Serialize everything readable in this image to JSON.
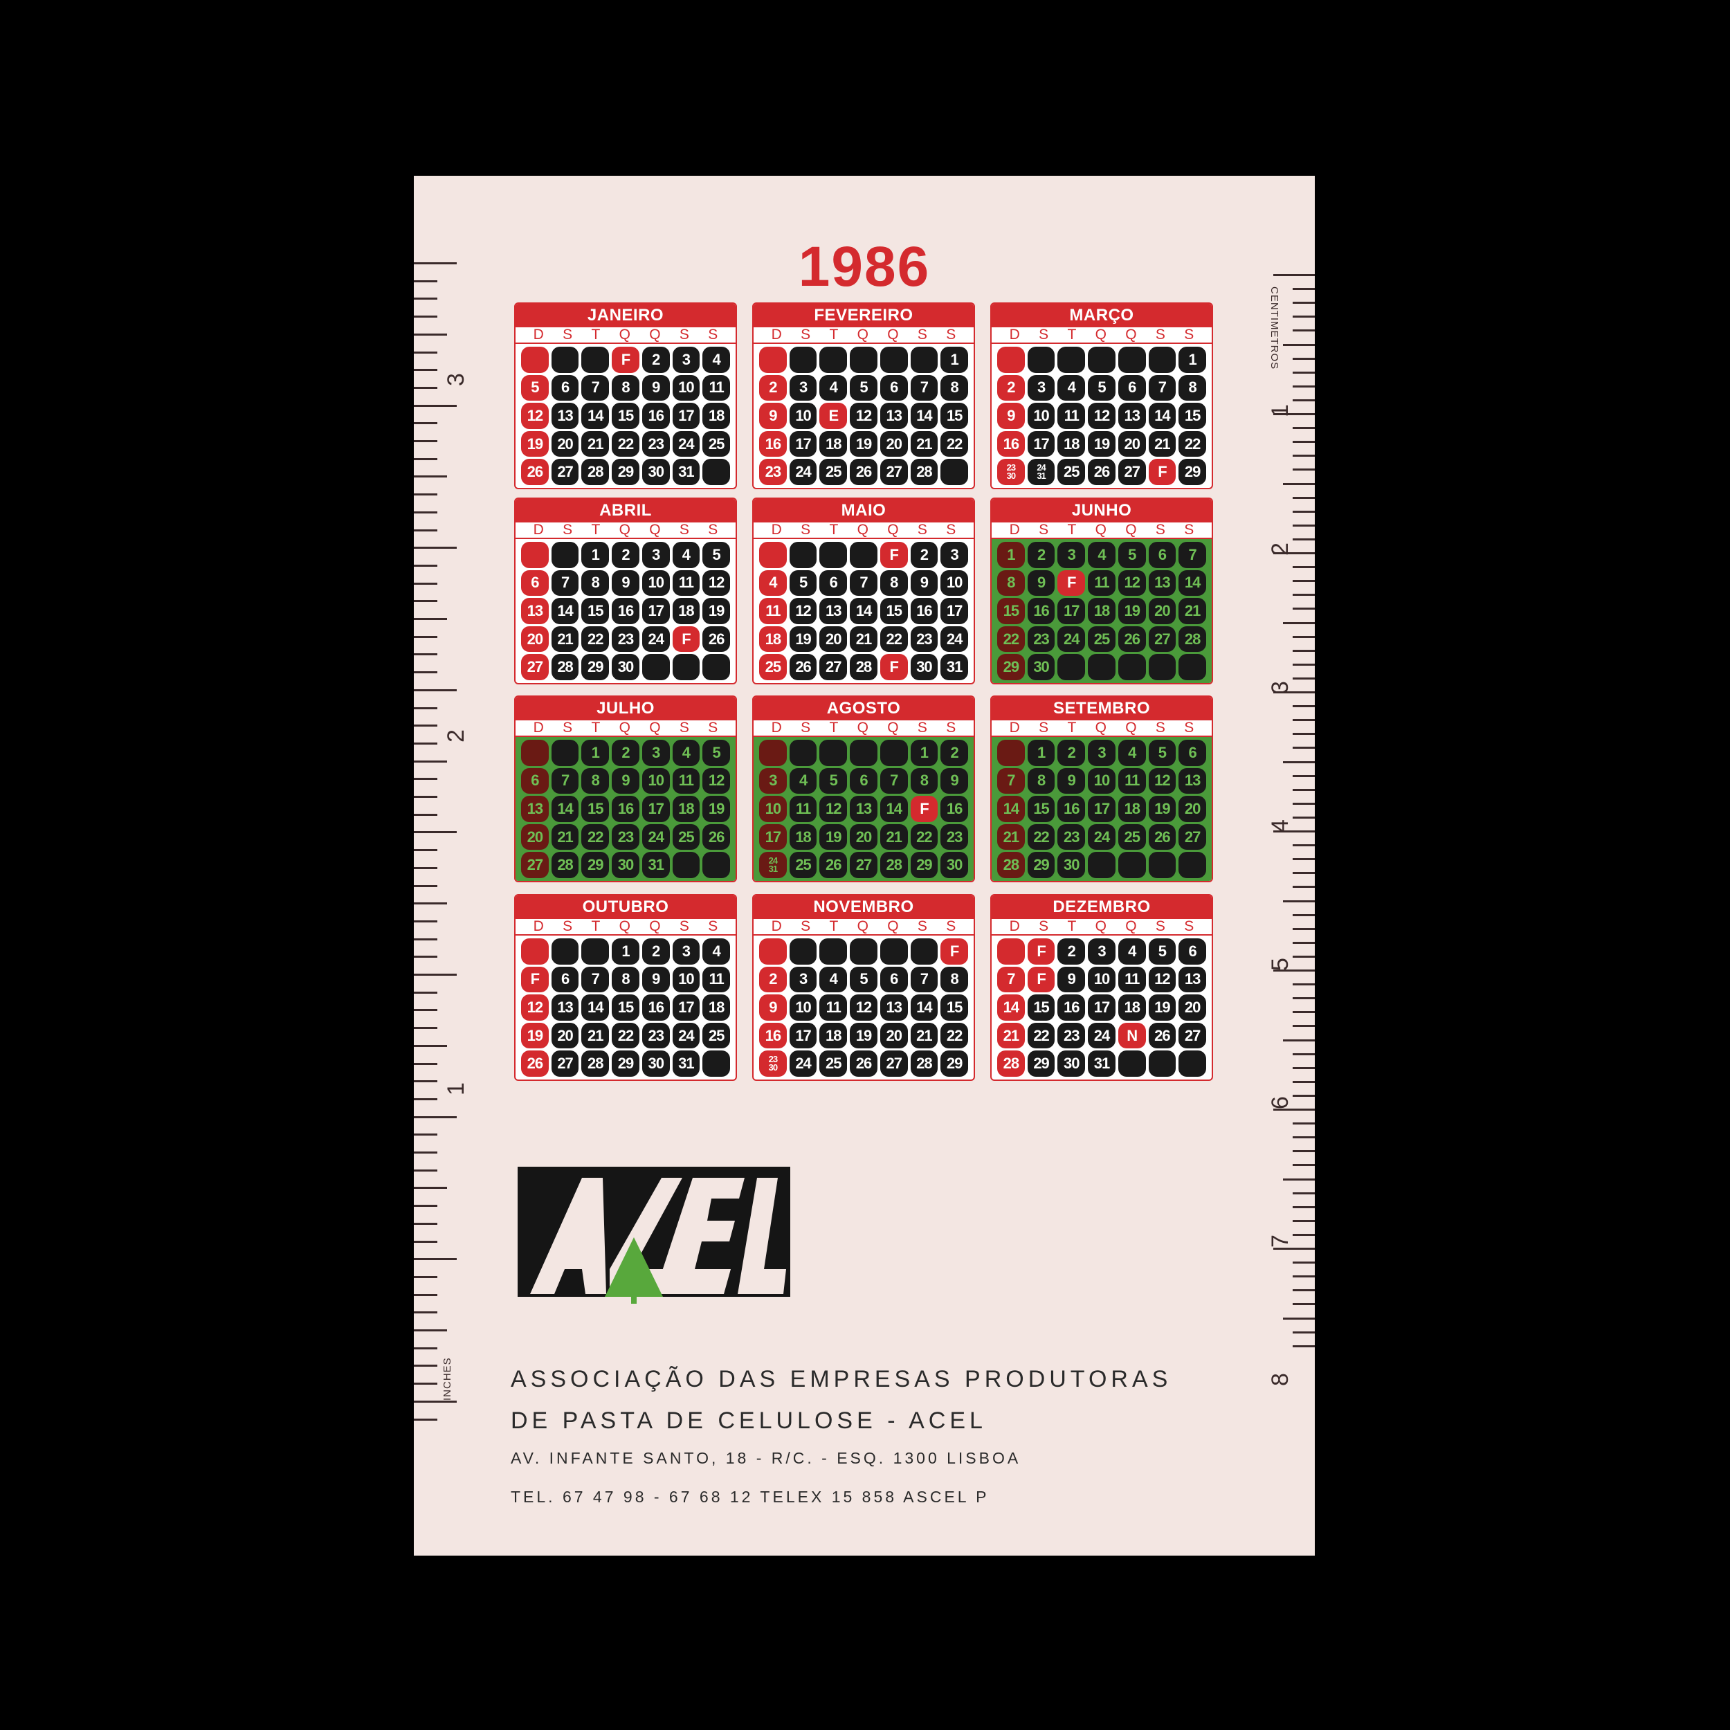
{
  "year": "1986",
  "ruler": {
    "inches_label": "INCHES",
    "cm_label": "CENTIMETROS",
    "inch_numbers": [
      "3",
      "2",
      "1"
    ],
    "cm_numbers": [
      "1",
      "2",
      "3",
      "4",
      "5",
      "6",
      "7",
      "8"
    ]
  },
  "weekdays": [
    "D",
    "S",
    "T",
    "Q",
    "Q",
    "S",
    "S"
  ],
  "months": [
    {
      "name": "JANEIRO",
      "green": false,
      "start": 3,
      "days": 31,
      "holidays": [
        1
      ],
      "overlay": []
    },
    {
      "name": "FEVEREIRO",
      "green": false,
      "start": 6,
      "days": 28,
      "holidays": [],
      "marks": {
        "11": "E"
      },
      "overlay": []
    },
    {
      "name": "MARÇO",
      "green": false,
      "start": 6,
      "days": 31,
      "holidays": [
        28
      ],
      "overlay": [
        [
          23,
          30
        ],
        [
          24,
          31
        ]
      ]
    },
    {
      "name": "ABRIL",
      "green": false,
      "start": 2,
      "days": 30,
      "holidays": [
        25
      ],
      "overlay": []
    },
    {
      "name": "MAIO",
      "green": false,
      "start": 4,
      "days": 31,
      "holidays": [
        1,
        29
      ],
      "overlay": []
    },
    {
      "name": "JUNHO",
      "green": true,
      "start": 0,
      "days": 30,
      "holidays": [
        10
      ],
      "overlay": []
    },
    {
      "name": "JULHO",
      "green": true,
      "start": 2,
      "days": 31,
      "holidays": [],
      "overlay": []
    },
    {
      "name": "AGOSTO",
      "green": true,
      "start": 5,
      "days": 31,
      "holidays": [
        15
      ],
      "overlay": [
        [
          24,
          31
        ]
      ]
    },
    {
      "name": "SETEMBRO",
      "green": true,
      "start": 1,
      "days": 30,
      "holidays": [],
      "overlay": []
    },
    {
      "name": "OUTUBRO",
      "green": false,
      "start": 3,
      "days": 31,
      "holidays": [
        5
      ],
      "overlay": []
    },
    {
      "name": "NOVEMBRO",
      "green": false,
      "start": 6,
      "days": 30,
      "holidays": [
        1
      ],
      "overlay": [
        [
          23,
          30
        ]
      ]
    },
    {
      "name": "DEZEMBRO",
      "green": false,
      "start": 1,
      "days": 31,
      "holidays": [
        1,
        8
      ],
      "marks": {
        "25": "N"
      },
      "overlay": []
    }
  ],
  "holiday_mark": "F",
  "logo": {
    "text": "ACEL"
  },
  "address": {
    "line1": "ASSOCIAÇÃO DAS EMPRESAS PRODUTORAS",
    "line2": "DE PASTA DE CELULOSE - ACEL",
    "line3": "AV. INFANTE SANTO, 18 - R/C. - ESQ.   1300   LISBOA",
    "line4": "TEL.   67 47 98 - 67 68 12   TELEX 15 858   ASCEL  P"
  },
  "colors": {
    "red": "#d42a2e",
    "green": "#4a9a3a",
    "card": "#f3e6e2"
  }
}
